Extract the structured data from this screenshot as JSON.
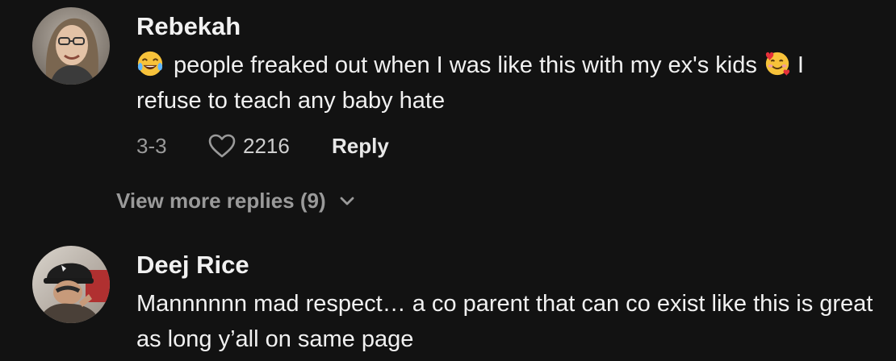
{
  "comments": [
    {
      "username": "Rebekah",
      "text_parts": {
        "lead_emoji": "face-with-tears-of-joy-emoji",
        "line_part1": "people freaked out when I was like this with my ex's kids",
        "inline_emoji": "smiling-face-with-hearts-emoji",
        "line_part2": "I refuse to teach any baby hate"
      },
      "date": "3-3",
      "likes": "2216",
      "reply_label": "Reply",
      "view_more_label": "View more replies (9)"
    },
    {
      "username": "Deej Rice",
      "text": "Mannnnnn mad respect… a co parent that can co exist like this is great as long y’all on same page"
    }
  ],
  "colors": {
    "background": "#121212",
    "primary_text": "#f1f1f1",
    "secondary_text": "#9a9a9a"
  },
  "icons": {
    "like": "heart-outline-icon",
    "expand": "chevron-down-icon"
  }
}
